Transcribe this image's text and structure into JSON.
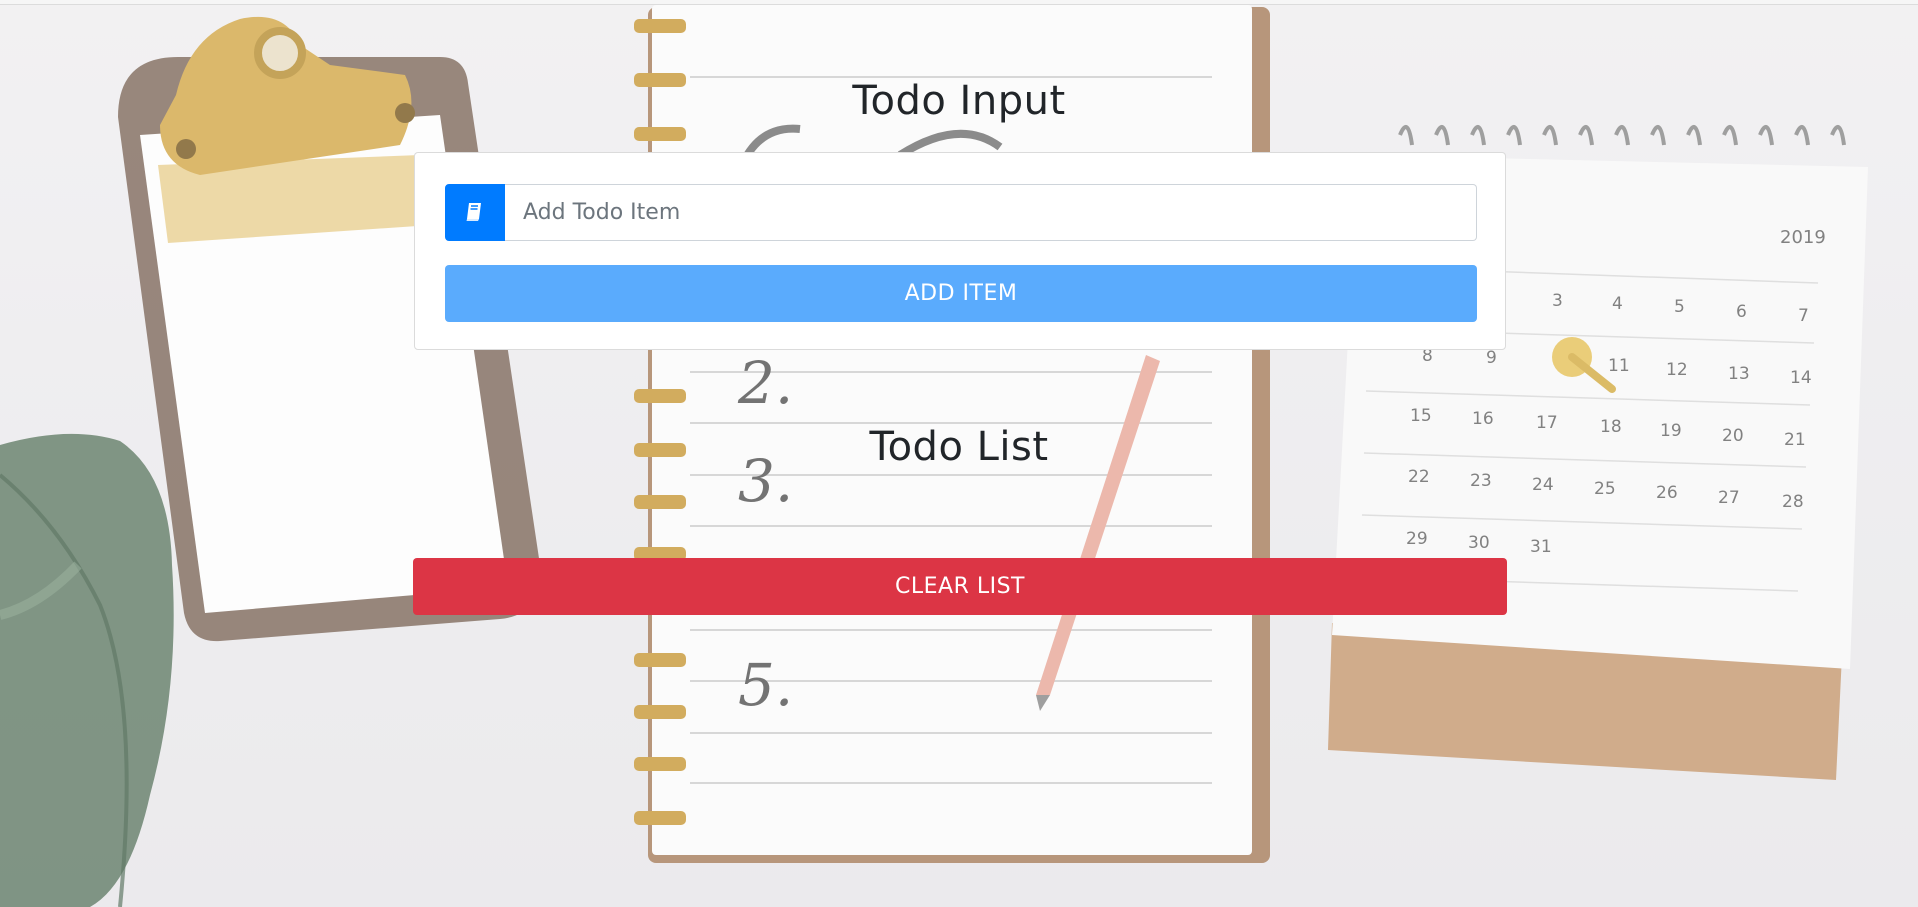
{
  "input_section": {
    "title": "Todo Input",
    "placeholder": "Add Todo Item",
    "value": "",
    "input_icon": "book-icon",
    "add_label": "ADD ITEM"
  },
  "list_section": {
    "title": "Todo List",
    "items": [],
    "clear_label": "CLEAR LIST"
  },
  "colors": {
    "primary": "#007bff",
    "add_button": "#5aabfd",
    "clear_button": "#dc3545",
    "heading": "#212529"
  },
  "background": {
    "notebook_numbers": [
      "2.",
      "3.",
      "5."
    ],
    "calendar_year": "2019",
    "calendar_days": [
      "3",
      "4",
      "5",
      "6",
      "7",
      "8",
      "9",
      "11",
      "12",
      "13",
      "14",
      "15",
      "16",
      "17",
      "18",
      "19",
      "20",
      "21",
      "22",
      "23",
      "24",
      "25",
      "26",
      "27",
      "28",
      "29",
      "30",
      "31"
    ]
  }
}
